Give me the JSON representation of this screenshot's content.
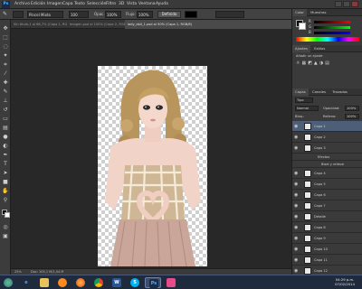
{
  "app": {
    "logo": "Ps"
  },
  "menu": [
    "Archivo",
    "Edición",
    "Imagen",
    "Capa",
    "Texto",
    "Selección",
    "Filtro",
    "3D",
    "Vista",
    "Ventana",
    "Ayuda"
  ],
  "options": {
    "brush_mode": "Pincel Mixto",
    "size_value": "100",
    "opacity_label": "Opac.",
    "opacity_value": "100%",
    "flow_label": "Flujo:",
    "flow_value": "100%",
    "button_label": "Definido"
  },
  "tabs": [
    {
      "label": "Sin título-1 al 66,7% (Capa 1, RGB/8)",
      "active": false
    },
    {
      "label": "Imagen.psd al 100% (Capa 2, RGB/8)",
      "active": false
    },
    {
      "label": "lady_doll_1.psd al 50% (Capa 1, RGB/8)",
      "active": true
    }
  ],
  "status": {
    "zoom": "25%",
    "doc": "Doc: 105,1 M/1,04 M"
  },
  "color_panel": {
    "tabs": [
      "Color",
      "Muestras"
    ],
    "channels": [
      "R",
      "G",
      "B"
    ]
  },
  "adjust_panel": {
    "tabs": [
      "Ajustes",
      "Estilos"
    ],
    "heading": "Añadir un ajuste"
  },
  "layers_panel": {
    "tabs": [
      "Capas",
      "Canales",
      "Trazados"
    ],
    "filter": "Tipo",
    "blend": "Normal",
    "opacity_label": "Opacidad:",
    "opacity_value": "100%",
    "lock_label": "Bloq.:",
    "fill_label": "Relleno:",
    "fill_value": "100%",
    "layers": [
      {
        "name": "Capa 1",
        "selected": true
      },
      {
        "name": "Capa 2",
        "selected": false
      },
      {
        "name": "Capa 3",
        "selected": false
      },
      {
        "name": "Efectos",
        "selected": false
      },
      {
        "name": "Bisel y relieve",
        "selected": false
      },
      {
        "name": "Capa 4",
        "selected": false
      },
      {
        "name": "Capa 5",
        "selected": false
      },
      {
        "name": "Capa 6",
        "selected": false
      },
      {
        "name": "Capa 7",
        "selected": false
      },
      {
        "name": "Detalle",
        "selected": false
      },
      {
        "name": "Capa 8",
        "selected": false
      },
      {
        "name": "Capa 9",
        "selected": false
      },
      {
        "name": "Capa 10",
        "selected": false
      },
      {
        "name": "Capa 11",
        "selected": false
      },
      {
        "name": "Capa 12",
        "selected": false
      }
    ]
  },
  "taskbar": {
    "apps": [
      {
        "icon": "windows-start-icon"
      },
      {
        "icon": "internet-explorer-icon"
      },
      {
        "icon": "file-explorer-icon"
      },
      {
        "icon": "media-player-icon"
      },
      {
        "icon": "firefox-icon"
      },
      {
        "icon": "chrome-icon"
      },
      {
        "icon": "word-icon"
      },
      {
        "icon": "skype-icon"
      },
      {
        "icon": "photoshop-icon"
      },
      {
        "icon": "paint-icon"
      }
    ],
    "time": "04:29 p.m.",
    "date": "07/02/2014"
  },
  "colors": {
    "accent": "#4d5f78",
    "ps_blue": "#4fb1ff",
    "background": "#282828"
  }
}
